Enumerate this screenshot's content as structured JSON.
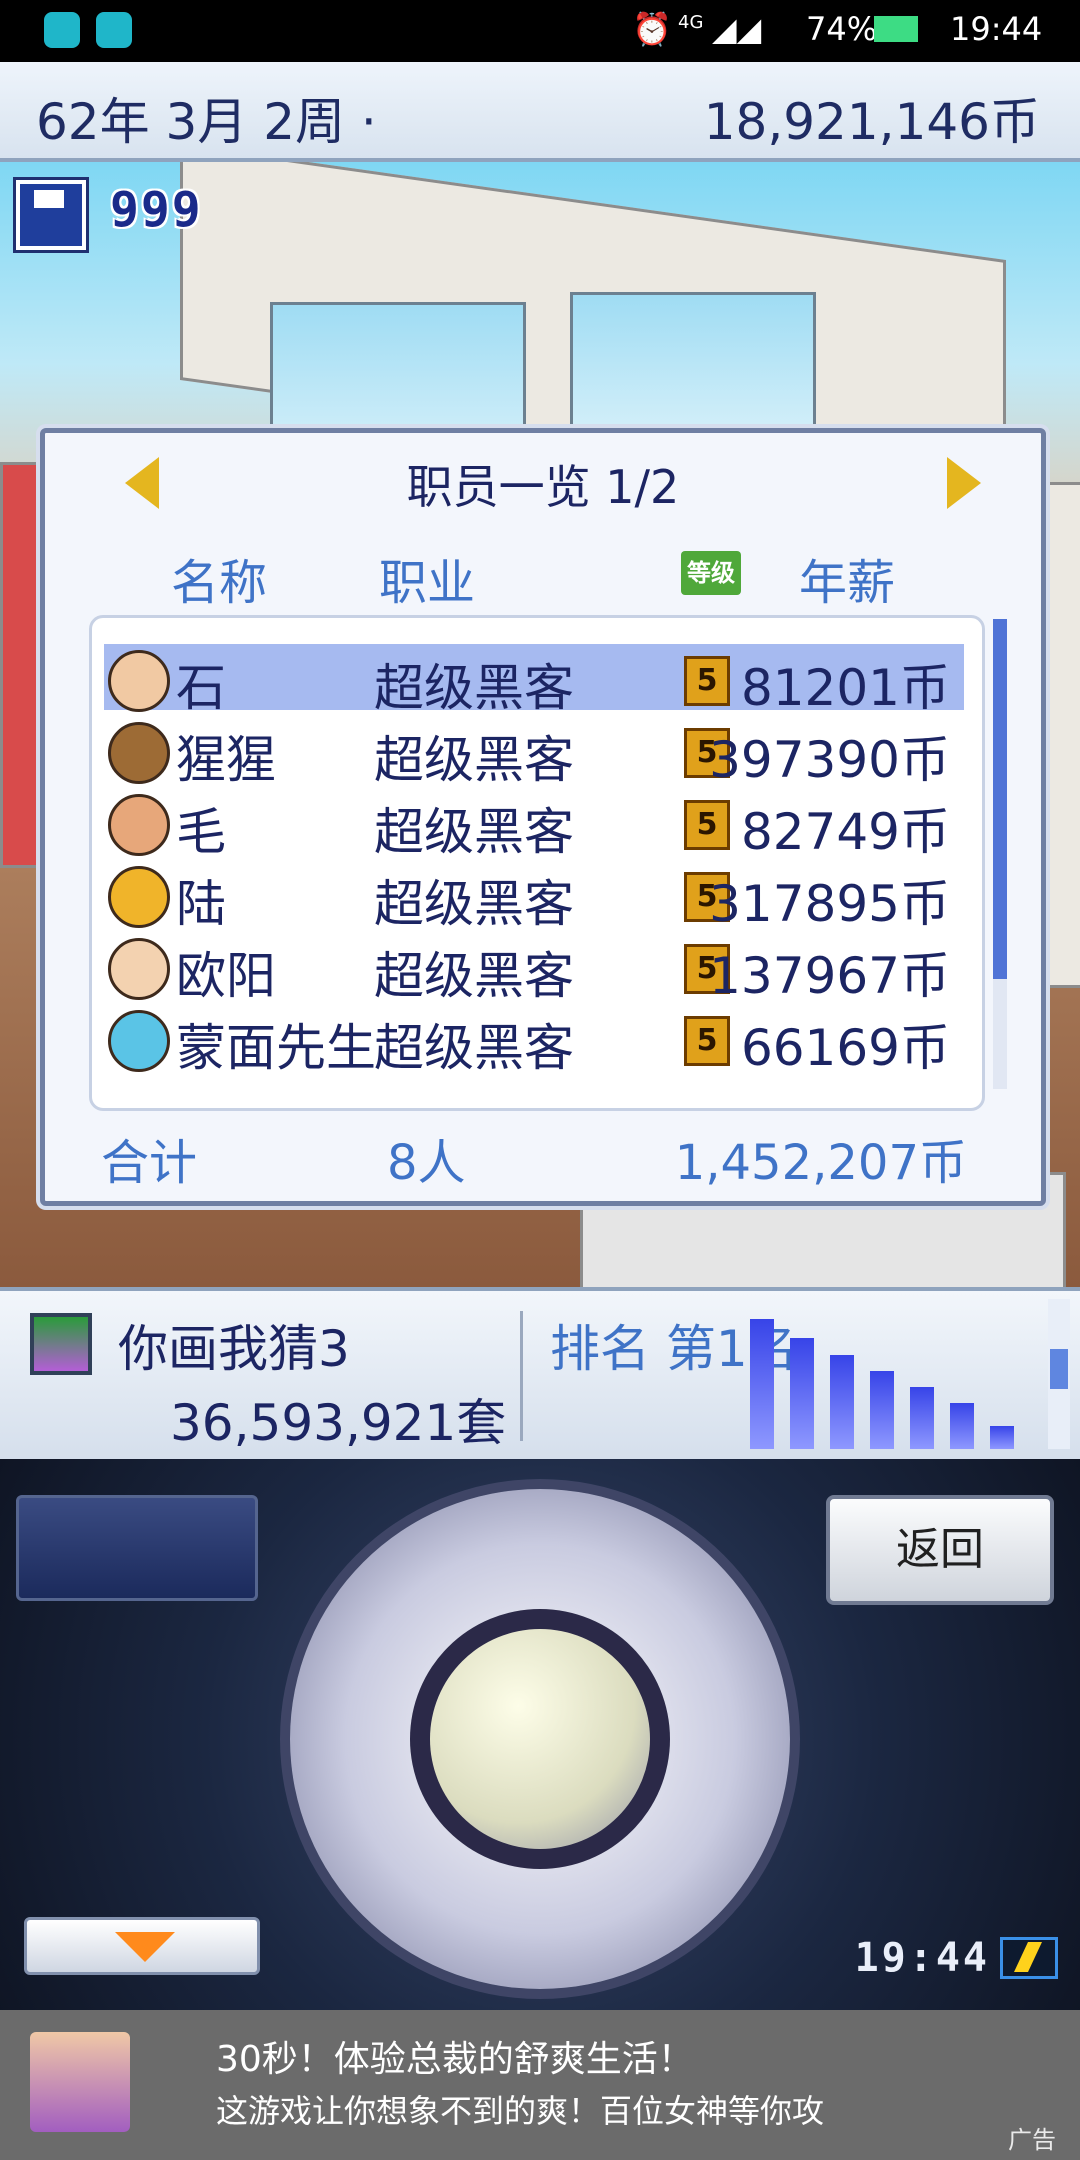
{
  "status_bar": {
    "battery_percent": "74%",
    "network": "4G",
    "time": "19:44"
  },
  "header": {
    "date": "62年 3月 2周 ·",
    "money": "18,921,146币"
  },
  "scene": {
    "save_count": "999"
  },
  "staff_panel": {
    "title": "职员一览 1/2",
    "columns": {
      "name": "名称",
      "job": "职业",
      "level": "等级",
      "salary": "年薪"
    },
    "rows": [
      {
        "name": "石",
        "job": "超级黑客",
        "level": "5",
        "salary": "81201币",
        "selected": true
      },
      {
        "name": "猩猩",
        "job": "超级黑客",
        "level": "5",
        "salary": "397390币"
      },
      {
        "name": "毛",
        "job": "超级黑客",
        "level": "5",
        "salary": "82749币"
      },
      {
        "name": "陆",
        "job": "超级黑客",
        "level": "5",
        "salary": "317895币"
      },
      {
        "name": "欧阳",
        "job": "超级黑客",
        "level": "5",
        "salary": "137967币"
      },
      {
        "name": "蒙面先生",
        "job": "超级黑客",
        "level": "5",
        "salary": "66169币"
      }
    ],
    "footer": {
      "label": "合计",
      "count": "8人",
      "total": "1,452,207币"
    }
  },
  "product": {
    "name": "你画我猜3",
    "sales": "36,593,921套",
    "rank": "排名 第1名",
    "trend_levels": [
      1.0,
      0.85,
      0.72,
      0.6,
      0.48,
      0.35,
      0.18
    ]
  },
  "controls": {
    "back_label": "返回",
    "clock": "19:44"
  },
  "ad": {
    "title": "30秒！体验总裁的舒爽生活！",
    "subtitle": "这游戏让你想象不到的爽！百位女神等你攻",
    "label": "广告"
  }
}
